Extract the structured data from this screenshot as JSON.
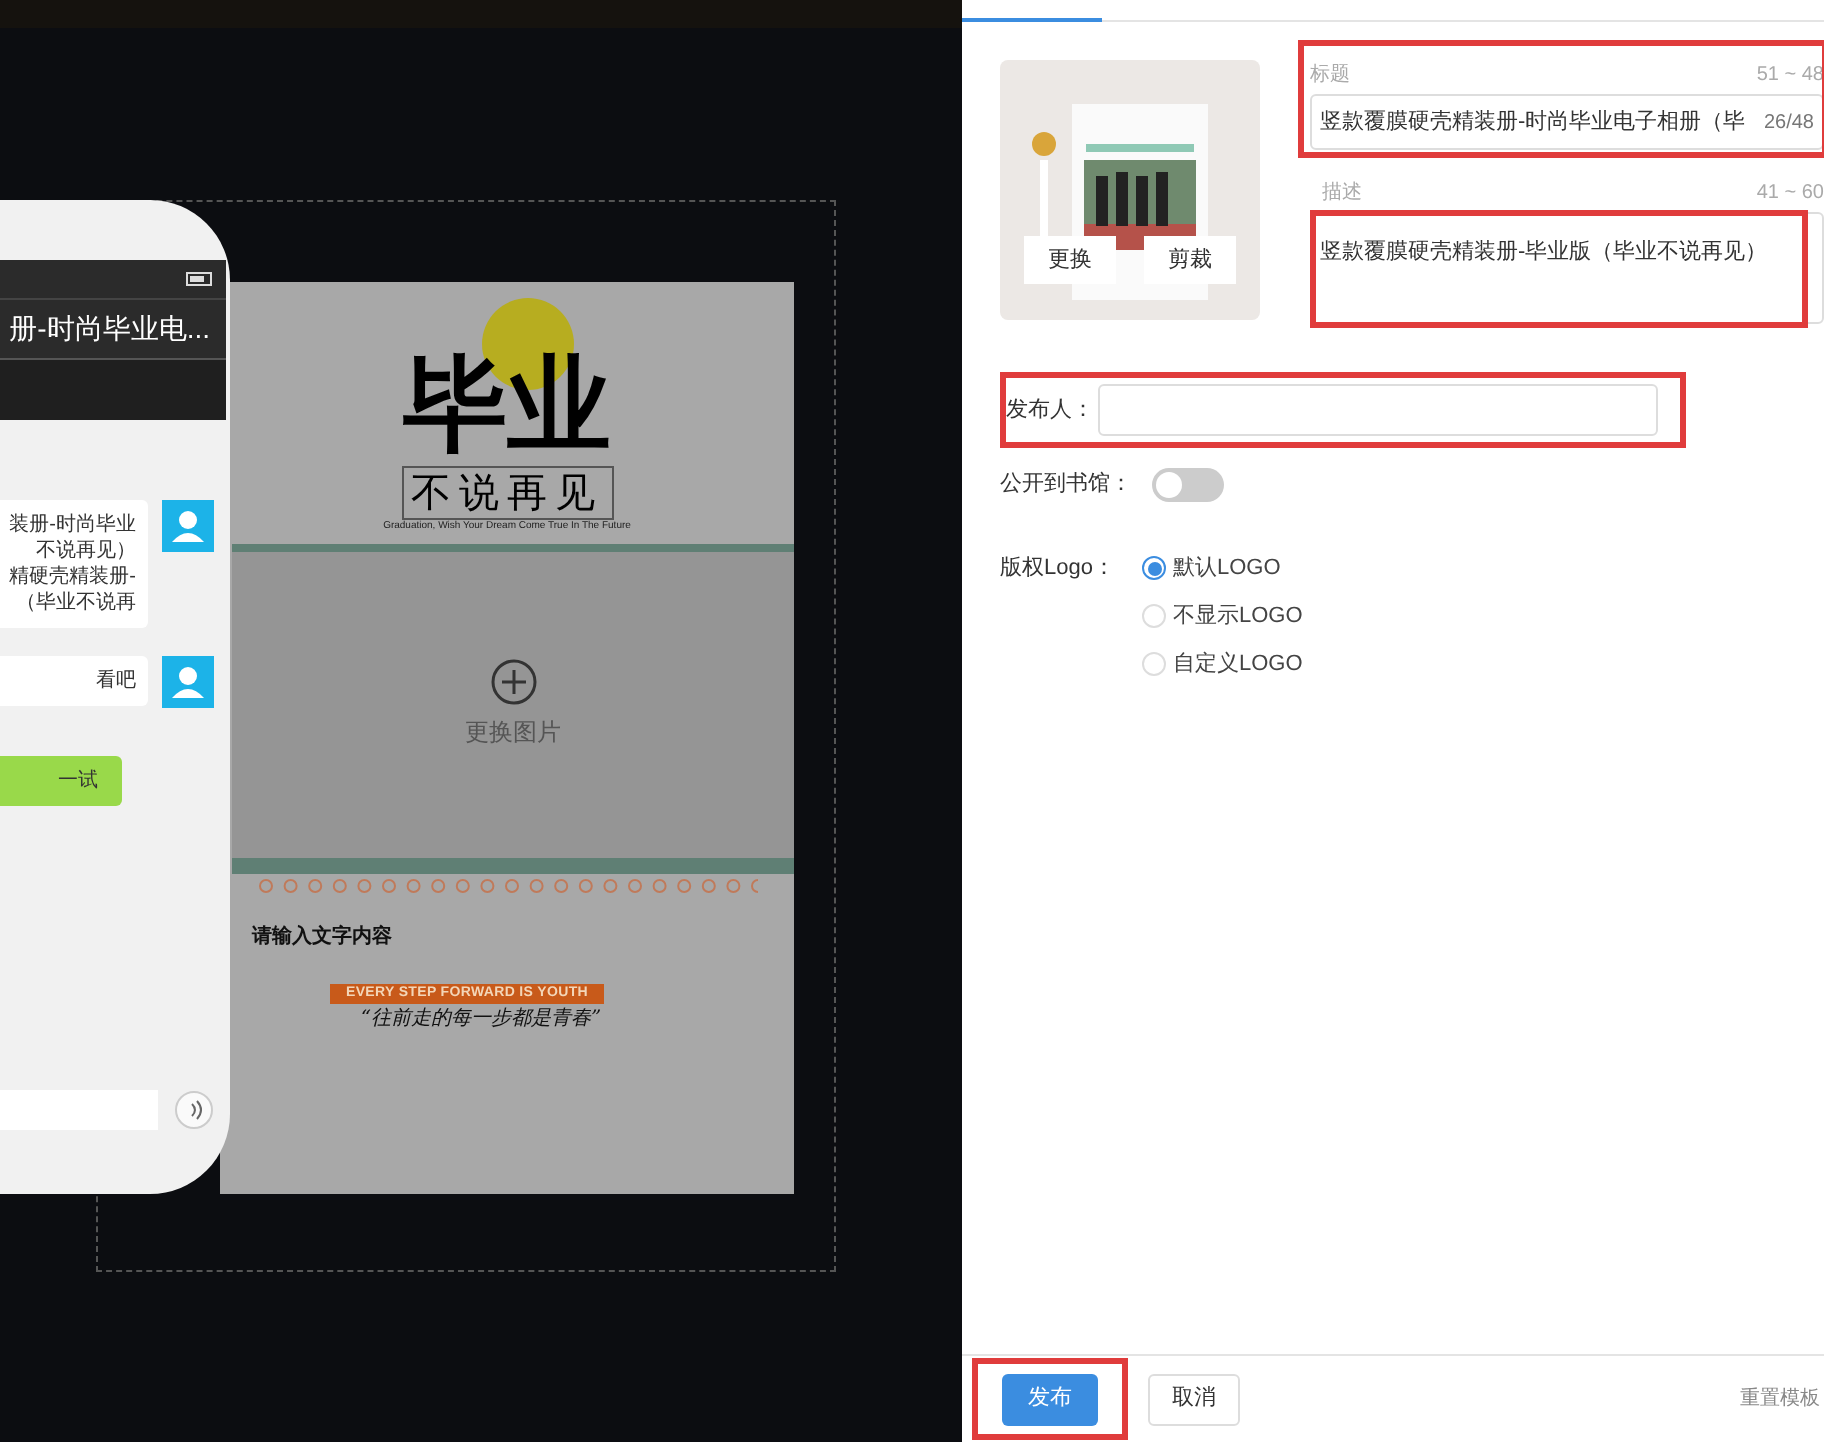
{
  "phone": {
    "title": "册-时尚毕业电...",
    "messages": [
      {
        "lines": [
          "装册-时尚毕业",
          "不说再见）",
          "精硬壳精装册-",
          "（毕业不说再"
        ]
      },
      {
        "lines": [
          "看吧"
        ]
      }
    ],
    "action_button": "一试"
  },
  "poster": {
    "headline": "毕业",
    "subtitle": "不说再见",
    "tagline": "Graduation, Wish Your Dream Come True In The Future",
    "replace_image": "更换图片",
    "text_placeholder": "请输入文字内容",
    "banner": "EVERY STEP FORWARD IS YOUTH",
    "quote": "“往前走的每一步都是青春”"
  },
  "cover": {
    "buttons": [
      "更换",
      "剪裁"
    ]
  },
  "title_field": {
    "label": "标题",
    "range": "51 ~ 48",
    "value": "竖款覆膜硬壳精装册-时尚毕业电子相册（毕",
    "count": "26/48"
  },
  "description_field": {
    "label": "描述",
    "range": "41 ~ 60",
    "value": "竖款覆膜硬壳精装册-毕业版（毕业不说再见）"
  },
  "publisher": {
    "label": "发布人："
  },
  "public_switch": {
    "label": "公开到书馆：",
    "on": false
  },
  "logo": {
    "label": "版权Logo：",
    "options": [
      {
        "label": "默认LOGO",
        "selected": true
      },
      {
        "label": "不显示LOGO",
        "selected": false
      },
      {
        "label": "自定义LOGO",
        "selected": false
      }
    ]
  },
  "footer": {
    "publish": "发布",
    "cancel": "取消",
    "reset": "重置模板"
  }
}
